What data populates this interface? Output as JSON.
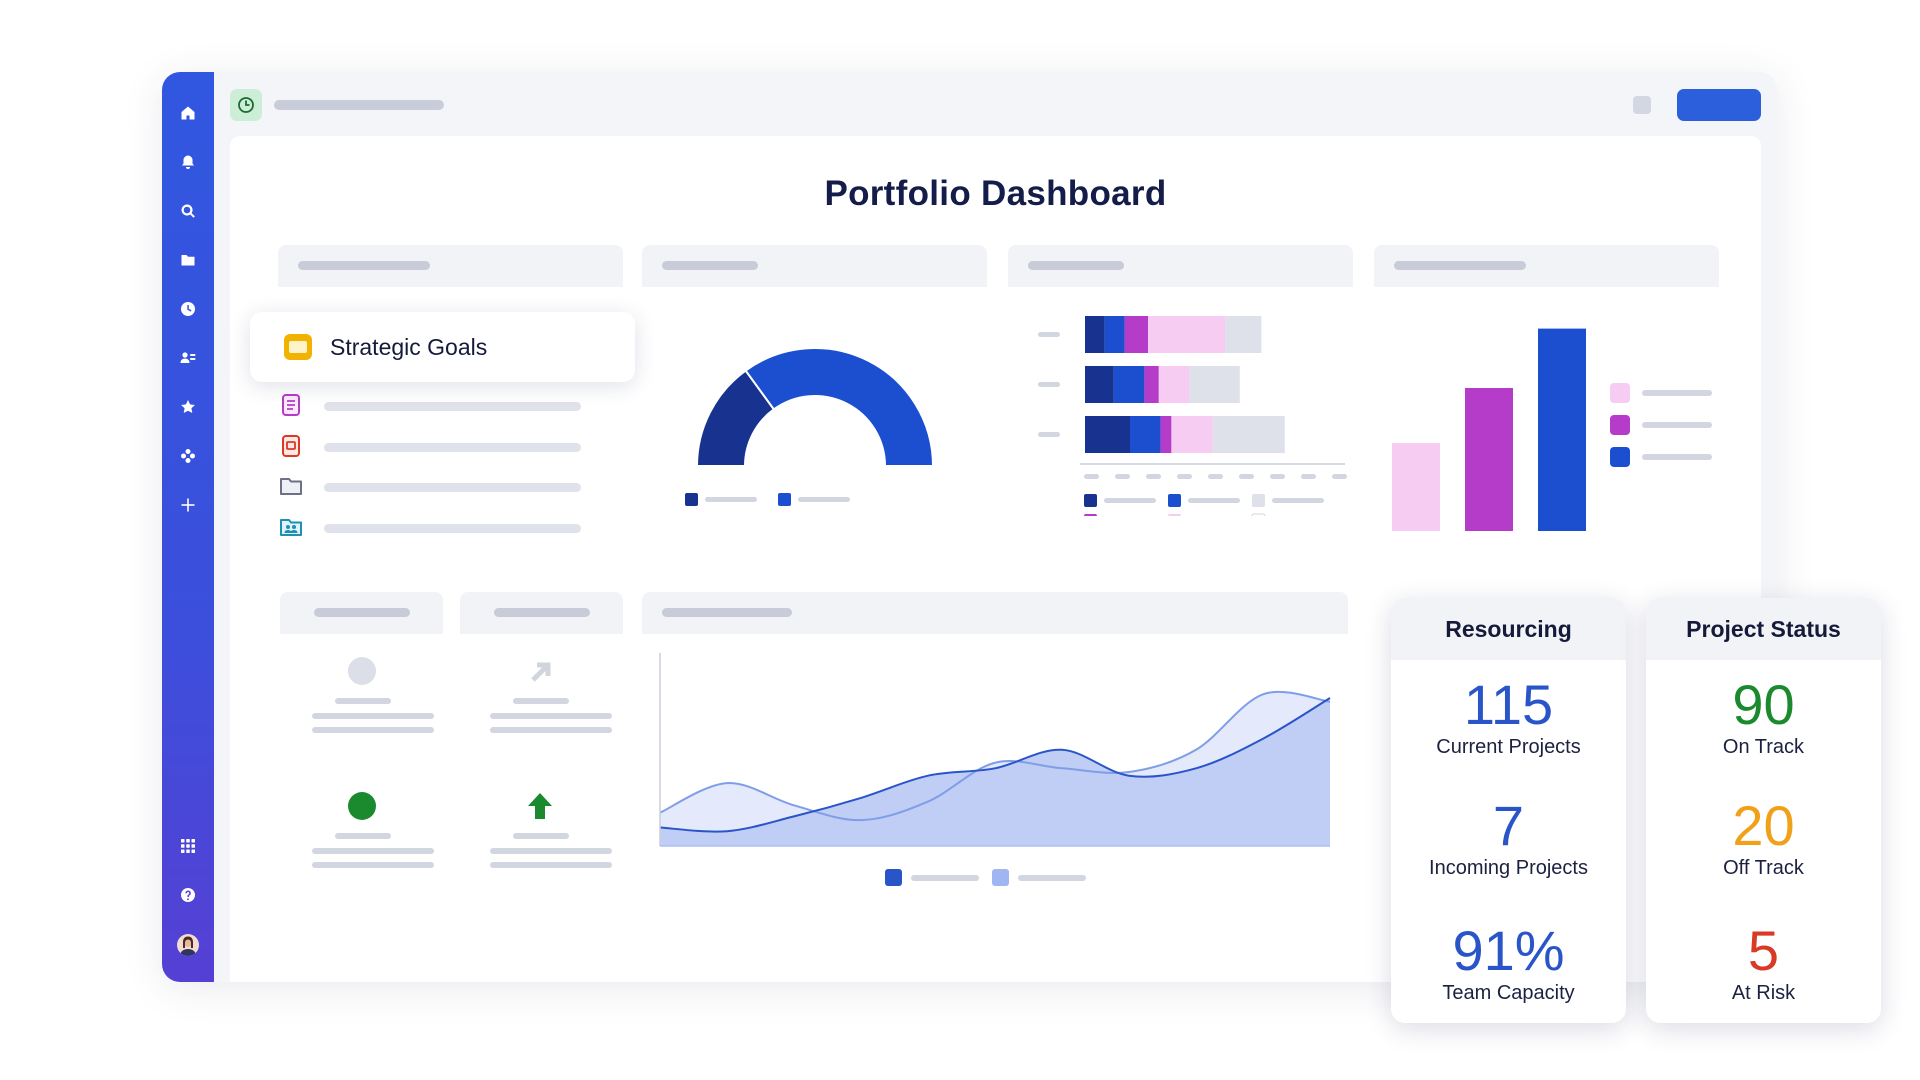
{
  "page": {
    "title": "Portfolio Dashboard"
  },
  "sidebar": {
    "icons": [
      "home-icon",
      "bell-icon",
      "search-icon",
      "folder-icon",
      "clock-icon",
      "people-icon",
      "star-icon",
      "apps-icon",
      "plus-icon"
    ],
    "bottom_icons": [
      "grid-icon",
      "help-icon",
      "avatar"
    ]
  },
  "strategic_goals": {
    "label": "Strategic Goals",
    "list_icons": [
      "document-icon",
      "report-icon",
      "folder-icon",
      "team-folder-icon"
    ]
  },
  "colors": {
    "navy": "#17338f",
    "blue": "#1b4fd0",
    "purple": "#b43cc8",
    "pink": "#f6ccf2",
    "gray": "#dfe1ea",
    "green": "#1b8a2e",
    "orange": "#f0a119",
    "red": "#d93a26",
    "kpi_blue": "#2a55c8"
  },
  "resourcing": {
    "title": "Resourcing",
    "items": [
      {
        "value": "115",
        "label": "Current Projects"
      },
      {
        "value": "7",
        "label": "Incoming Projects"
      },
      {
        "value": "91%",
        "label": "Team Capacity"
      }
    ]
  },
  "project_status": {
    "title": "Project Status",
    "items": [
      {
        "value": "90",
        "label": "On Track"
      },
      {
        "value": "20",
        "label": "Off Track"
      },
      {
        "value": "5",
        "label": "At Risk"
      }
    ]
  },
  "chart_data": [
    {
      "type": "pie",
      "subtype": "semi-donut",
      "values": [
        30,
        70
      ]
    },
    {
      "type": "bar",
      "orientation": "horizontal",
      "stacked": true,
      "rows": [
        [
          11,
          11,
          13,
          43,
          20
        ],
        [
          16,
          17,
          8,
          17,
          28
        ],
        [
          25,
          17,
          6,
          23,
          40
        ]
      ]
    },
    {
      "type": "bar",
      "values": [
        40,
        65,
        92
      ],
      "ylim": [
        0,
        100
      ]
    },
    {
      "type": "area",
      "x": [
        0,
        1,
        2,
        3,
        4,
        5,
        6,
        7,
        8,
        9,
        10
      ],
      "series": [
        {
          "values": [
            18,
            34,
            22,
            14,
            24,
            45,
            42,
            40,
            52,
            82,
            78
          ]
        },
        {
          "values": [
            10,
            8,
            16,
            26,
            38,
            42,
            52,
            38,
            42,
            58,
            80
          ]
        }
      ],
      "ylim": [
        0,
        100
      ]
    }
  ]
}
